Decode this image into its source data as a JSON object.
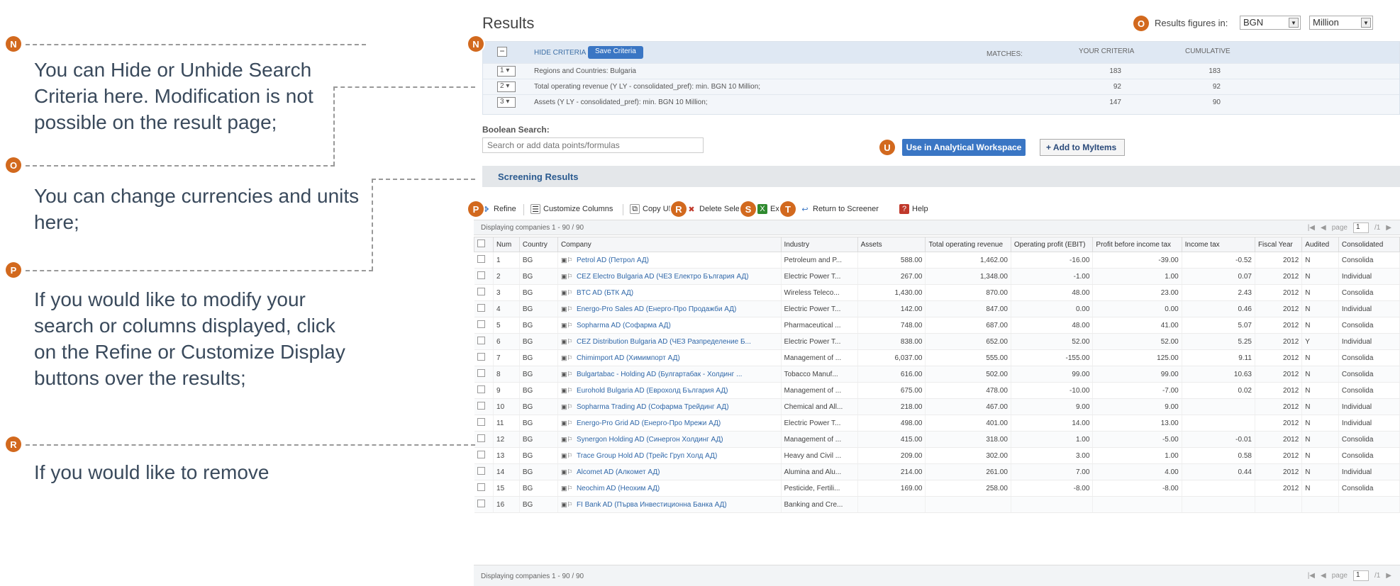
{
  "annotations": {
    "N": {
      "marker": "N",
      "lines": [
        "You can Hide or Unhide Search",
        "Criteria here. Modification is not",
        "possible on the result page;"
      ]
    },
    "O": {
      "marker": "O",
      "lines": [
        "You can change currencies and units",
        "here;"
      ]
    },
    "P": {
      "marker": "P",
      "lines": [
        "If you would like to modify your",
        "search or columns displayed, click",
        "on the Refine or Customize Display",
        "buttons over the results;"
      ]
    },
    "R": {
      "marker": "R",
      "lines": [
        "If you would like to remove"
      ]
    },
    "in_app_markers": [
      "N",
      "O",
      "P",
      "R",
      "S",
      "T",
      "U"
    ]
  },
  "header": {
    "title": "Results",
    "figures_label": "Results figures in:",
    "currency": "BGN",
    "unit": "Million"
  },
  "criteria": {
    "hide_label": "HIDE CRITERIA",
    "save_label": "Save Criteria",
    "matches_label": "MATCHES:",
    "your_criteria_label": "YOUR CRITERIA",
    "cumulative_label": "CUMULATIVE",
    "rows": [
      {
        "num": "1",
        "text": "Regions and Countries: Bulgaria",
        "matches": "183",
        "cumulative": "183"
      },
      {
        "num": "2",
        "text": "Total operating revenue (Y LY - consolidated_pref): min. BGN 10 Million;",
        "matches": "92",
        "cumulative": "92"
      },
      {
        "num": "3",
        "text": "Assets (Y LY - consolidated_pref): min. BGN 10 Million;",
        "matches": "147",
        "cumulative": "90"
      }
    ]
  },
  "boolean_search": {
    "label": "Boolean Search:",
    "placeholder": "Search or add data points/formulas"
  },
  "actions": {
    "use_workspace": "Use in Analytical Workspace",
    "add_mytems": "+ Add to MyItems"
  },
  "screening_label": "Screening Results",
  "toolbar": {
    "refine": "Refine",
    "customize": "Customize Columns",
    "copy_url": "Copy URL",
    "delete": "Delete Selected",
    "export": "Export",
    "return": "Return to Screener",
    "help": "Help"
  },
  "grid": {
    "displaying": "Displaying companies 1 - 90 / 90",
    "page_label": "page",
    "page": "1",
    "page_of": "/1",
    "columns": [
      "Num",
      "Country",
      "Company",
      "Industry",
      "Assets",
      "Total operating revenue",
      "Operating profit (EBIT)",
      "Profit before income tax",
      "Income tax",
      "Fiscal Year",
      "Audited",
      "Consolidated"
    ],
    "rows": [
      {
        "num": "1",
        "country": "BG",
        "company": "Petrol AD (Петрол АД)",
        "industry": "Petroleum and P...",
        "assets": "588.00",
        "revenue": "1,462.00",
        "op": "-16.00",
        "pbt": "-39.00",
        "tax": "-0.52",
        "year": "2012",
        "audited": "N",
        "cons": "Consolida"
      },
      {
        "num": "2",
        "country": "BG",
        "company": "CEZ Electro Bulgaria AD (ЧЕЗ Електро България АД)",
        "industry": "Electric Power T...",
        "assets": "267.00",
        "revenue": "1,348.00",
        "op": "-1.00",
        "pbt": "1.00",
        "tax": "0.07",
        "year": "2012",
        "audited": "N",
        "cons": "Individual"
      },
      {
        "num": "3",
        "country": "BG",
        "company": "BTC AD (БТК АД)",
        "industry": "Wireless Teleco...",
        "assets": "1,430.00",
        "revenue": "870.00",
        "op": "48.00",
        "pbt": "23.00",
        "tax": "2.43",
        "year": "2012",
        "audited": "N",
        "cons": "Consolida"
      },
      {
        "num": "4",
        "country": "BG",
        "company": "Energo-Pro Sales AD (Енерго-Про Продажби АД)",
        "industry": "Electric Power T...",
        "assets": "142.00",
        "revenue": "847.00",
        "op": "0.00",
        "pbt": "0.00",
        "tax": "0.46",
        "year": "2012",
        "audited": "N",
        "cons": "Individual"
      },
      {
        "num": "5",
        "country": "BG",
        "company": "Sopharma AD (Софарма АД)",
        "industry": "Pharmaceutical ...",
        "assets": "748.00",
        "revenue": "687.00",
        "op": "48.00",
        "pbt": "41.00",
        "tax": "5.07",
        "year": "2012",
        "audited": "N",
        "cons": "Consolida"
      },
      {
        "num": "6",
        "country": "BG",
        "company": "CEZ Distribution Bulgaria AD (ЧЕЗ Разпределение Б...",
        "industry": "Electric Power T...",
        "assets": "838.00",
        "revenue": "652.00",
        "op": "52.00",
        "pbt": "52.00",
        "tax": "5.25",
        "year": "2012",
        "audited": "Y",
        "cons": "Individual"
      },
      {
        "num": "7",
        "country": "BG",
        "company": "Chimimport AD (Химимпорт АД)",
        "industry": "Management of ...",
        "assets": "6,037.00",
        "revenue": "555.00",
        "op": "-155.00",
        "pbt": "125.00",
        "tax": "9.11",
        "year": "2012",
        "audited": "N",
        "cons": "Consolida"
      },
      {
        "num": "8",
        "country": "BG",
        "company": "Bulgartabac - Holding AD (Булгартабак - Холдинг ...",
        "industry": "Tobacco Manuf...",
        "assets": "616.00",
        "revenue": "502.00",
        "op": "99.00",
        "pbt": "99.00",
        "tax": "10.63",
        "year": "2012",
        "audited": "N",
        "cons": "Consolida"
      },
      {
        "num": "9",
        "country": "BG",
        "company": "Eurohold Bulgaria AD (Еврохолд България АД)",
        "industry": "Management of ...",
        "assets": "675.00",
        "revenue": "478.00",
        "op": "-10.00",
        "pbt": "-7.00",
        "tax": "0.02",
        "year": "2012",
        "audited": "N",
        "cons": "Consolida"
      },
      {
        "num": "10",
        "country": "BG",
        "company": "Sopharma Trading AD (Софарма Трейдинг АД)",
        "industry": "Chemical and All...",
        "assets": "218.00",
        "revenue": "467.00",
        "op": "9.00",
        "pbt": "9.00",
        "tax": "",
        "year": "2012",
        "audited": "N",
        "cons": "Individual"
      },
      {
        "num": "11",
        "country": "BG",
        "company": "Energo-Pro Grid AD (Енерго-Про Мрежи АД)",
        "industry": "Electric Power T...",
        "assets": "498.00",
        "revenue": "401.00",
        "op": "14.00",
        "pbt": "13.00",
        "tax": "",
        "year": "2012",
        "audited": "N",
        "cons": "Individual"
      },
      {
        "num": "12",
        "country": "BG",
        "company": "Synergon Holding AD (Синергон Холдинг АД)",
        "industry": "Management of ...",
        "assets": "415.00",
        "revenue": "318.00",
        "op": "1.00",
        "pbt": "-5.00",
        "tax": "-0.01",
        "year": "2012",
        "audited": "N",
        "cons": "Consolida"
      },
      {
        "num": "13",
        "country": "BG",
        "company": "Trace Group Hold AD (Трейс Груп Холд АД)",
        "industry": "Heavy and Civil ...",
        "assets": "209.00",
        "revenue": "302.00",
        "op": "3.00",
        "pbt": "1.00",
        "tax": "0.58",
        "year": "2012",
        "audited": "N",
        "cons": "Consolida"
      },
      {
        "num": "14",
        "country": "BG",
        "company": "Alcomet AD (Алкомет АД)",
        "industry": "Alumina and Alu...",
        "assets": "214.00",
        "revenue": "261.00",
        "op": "7.00",
        "pbt": "4.00",
        "tax": "0.44",
        "year": "2012",
        "audited": "N",
        "cons": "Individual"
      },
      {
        "num": "15",
        "country": "BG",
        "company": "Neochim AD (Неохим АД)",
        "industry": "Pesticide, Fertili...",
        "assets": "169.00",
        "revenue": "258.00",
        "op": "-8.00",
        "pbt": "-8.00",
        "tax": "",
        "year": "2012",
        "audited": "N",
        "cons": "Consolida"
      },
      {
        "num": "16",
        "country": "BG",
        "company": "FI Bank AD (Първа Инвестиционна Банка АД)",
        "industry": "Banking and Cre...",
        "assets": "",
        "revenue": "",
        "op": "",
        "pbt": "",
        "tax": "",
        "year": "",
        "audited": "",
        "cons": ""
      }
    ]
  },
  "colors": {
    "marker": "#d2691e",
    "primary_button": "#3a76c4",
    "positive": "#2f8a2f",
    "negative": "#c0392b"
  }
}
